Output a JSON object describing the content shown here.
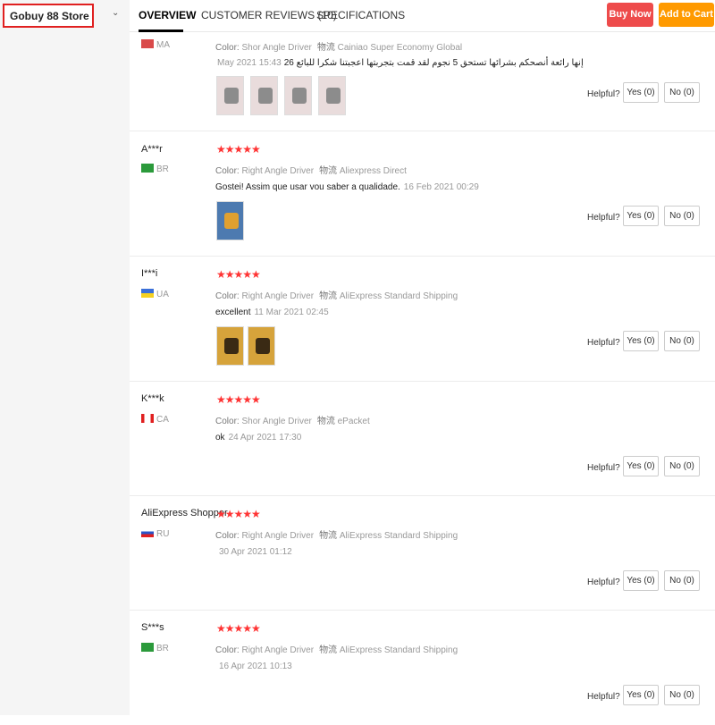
{
  "store": {
    "name": "Gobuy 88 Store"
  },
  "tabs": [
    "OVERVIEW",
    "CUSTOMER REVIEWS (10)",
    "SPECIFICATIONS"
  ],
  "actions": {
    "buy_now": "Buy Now",
    "add_to_cart": "Add to Cart"
  },
  "labels": {
    "helpful": "Helpful?",
    "color_prefix": "Color:",
    "shipping_prefix": "物流"
  },
  "reviews": [
    {
      "name": "",
      "country": "MA",
      "color": "Shor Angle Driver",
      "shipping": "Cainiao Super Economy Global",
      "text": "إنها رائعة أنصحكم بشرائها تستحق 5 نجوم لقد قمت بتجربتها اعجبتنا شكرا للبائع 26",
      "date": "May 2021 15:43",
      "photos": 4,
      "yes": "Yes (0)",
      "no": "No (0)"
    },
    {
      "name": "A***r",
      "country": "BR",
      "color": "Right Angle Driver",
      "shipping": "Aliexpress Direct",
      "text": "Gostei! Assim que usar vou saber a qualidade.",
      "date": "16 Feb 2021 00:29",
      "photos": 1,
      "yes": "Yes (0)",
      "no": "No (0)"
    },
    {
      "name": "I***i",
      "country": "UA",
      "color": "Right Angle Driver",
      "shipping": "AliExpress Standard Shipping",
      "text": "excellent",
      "date": "11 Mar 2021 02:45",
      "photos": 2,
      "yes": "Yes (0)",
      "no": "No (0)"
    },
    {
      "name": "K***k",
      "country": "CA",
      "color": "Shor Angle Driver",
      "shipping": "ePacket",
      "text": "ok",
      "date": "24 Apr 2021 17:30",
      "photos": 0,
      "yes": "Yes (0)",
      "no": "No (0)"
    },
    {
      "name": "AliExpress Shopper",
      "country": "RU",
      "color": "Right Angle Driver",
      "shipping": "AliExpress Standard Shipping",
      "text": "",
      "date": "30 Apr 2021 01:12",
      "photos": 0,
      "yes": "Yes (0)",
      "no": "No (0)"
    },
    {
      "name": "S***s",
      "country": "BR",
      "color": "Right Angle Driver",
      "shipping": "AliExpress Standard Shipping",
      "text": "",
      "date": "16 Apr 2021 10:13",
      "photos": 0,
      "yes": "Yes (0)",
      "no": "No (0)"
    }
  ],
  "colors": {
    "accent_red": "#ee4b4b",
    "accent_orange": "#ff9a00",
    "star": "#ff3333"
  }
}
